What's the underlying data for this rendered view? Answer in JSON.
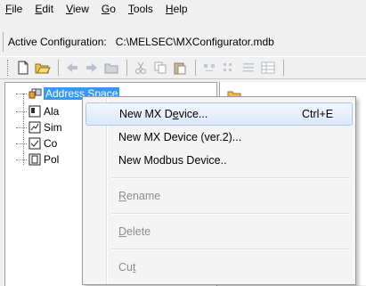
{
  "menubar": {
    "items": [
      {
        "mnemonic": "F",
        "rest": "ile"
      },
      {
        "mnemonic": "E",
        "rest": "dit"
      },
      {
        "mnemonic": "V",
        "rest": "iew"
      },
      {
        "mnemonic": "G",
        "rest": "o"
      },
      {
        "mnemonic": "T",
        "rest": "ools"
      },
      {
        "mnemonic": "H",
        "rest": "elp"
      }
    ]
  },
  "config": {
    "label": "Active Configuration:",
    "path": "C:\\MELSEC\\MXConfigurator.mdb"
  },
  "toolbar": {
    "icons": [
      "new-icon",
      "open-icon",
      "back-arrow-icon",
      "forward-arrow-icon",
      "folder-icon",
      "cut-icon",
      "copy-icon",
      "paste-icon",
      "large-icons-icon",
      "small-icons-icon",
      "list-icon",
      "details-icon"
    ]
  },
  "tree": {
    "items": [
      {
        "label": "Address Space",
        "selected": true
      },
      {
        "label": "Ala",
        "selected": false
      },
      {
        "label": "Sim",
        "selected": false
      },
      {
        "label": "Co",
        "selected": false
      },
      {
        "label": "Pol",
        "selected": false
      }
    ]
  },
  "context_menu": {
    "items": [
      {
        "pre": "New MX D",
        "mnemonic": "e",
        "post": "vice...",
        "shortcut": "Ctrl+E",
        "enabled": true,
        "highlighted": true
      },
      {
        "pre": "New MX Device (ver.2)...",
        "mnemonic": "",
        "post": "",
        "shortcut": "",
        "enabled": true,
        "highlighted": false
      },
      {
        "pre": "New Modbus Device..",
        "mnemonic": "",
        "post": "",
        "shortcut": "",
        "enabled": true,
        "highlighted": false
      },
      {
        "pre": "",
        "mnemonic": "R",
        "post": "ename",
        "shortcut": "",
        "enabled": false,
        "highlighted": false
      },
      {
        "pre": "",
        "mnemonic": "D",
        "post": "elete",
        "shortcut": "",
        "enabled": false,
        "highlighted": false
      },
      {
        "pre": "Cu",
        "mnemonic": "t",
        "post": "",
        "shortcut": "",
        "enabled": false,
        "highlighted": false
      }
    ]
  },
  "colors": {
    "selection": "#3399ff",
    "menu_hover_border": "#a8c8ec",
    "disabled_text": "#8d8d8d"
  }
}
